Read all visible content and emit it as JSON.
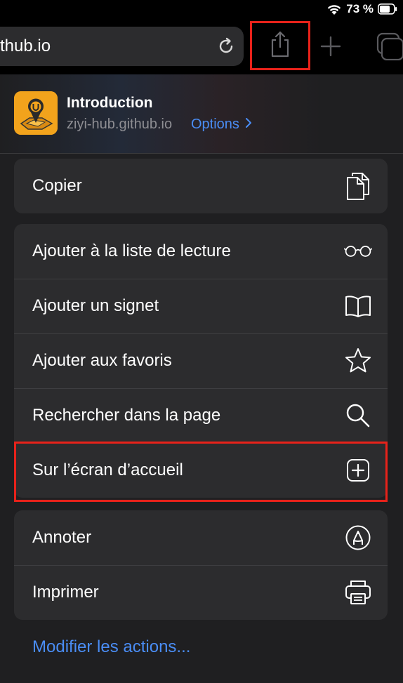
{
  "status_bar": {
    "battery_text": "73 %"
  },
  "toolbar": {
    "url_text": "thub.io",
    "icons": [
      "reload-icon",
      "share-icon",
      "plus-icon",
      "tabs-icon"
    ]
  },
  "site": {
    "title": "Introduction",
    "url": "ziyi-hub.github.io",
    "options_label": "Options"
  },
  "groups": [
    {
      "items": [
        {
          "label": "Copier",
          "icon": "copy-icon"
        }
      ]
    },
    {
      "items": [
        {
          "label": "Ajouter à la liste de lecture",
          "icon": "glasses-icon"
        },
        {
          "label": "Ajouter un signet",
          "icon": "book-icon"
        },
        {
          "label": "Ajouter aux favoris",
          "icon": "star-icon"
        },
        {
          "label": "Rechercher dans la page",
          "icon": "search-icon"
        },
        {
          "label": "Sur l’écran d’accueil",
          "icon": "add-square-icon"
        }
      ]
    },
    {
      "items": [
        {
          "label": "Annoter",
          "icon": "markup-icon"
        },
        {
          "label": "Imprimer",
          "icon": "printer-icon"
        }
      ]
    }
  ],
  "edit_actions_label": "Modifier les actions...",
  "colors": {
    "accent": "#4a8df5",
    "highlight": "#e8221a",
    "row_background": "#2c2c2e",
    "site_icon": "#f2a31c"
  }
}
